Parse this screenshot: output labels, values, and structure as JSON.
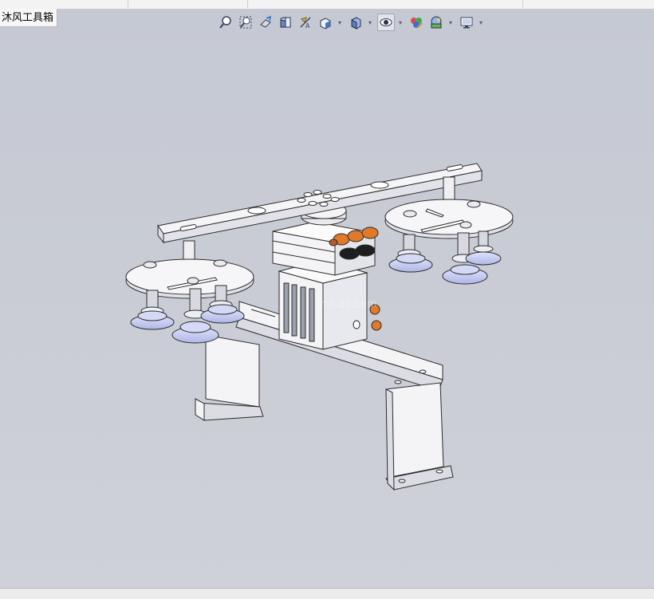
{
  "window": {
    "tab_label": "沐风工具箱",
    "watermark_text": "mfcad.com"
  },
  "hud_toolbar": {
    "buttons": [
      {
        "icon": "zoom-to-fit-icon"
      },
      {
        "icon": "zoom-to-area-icon"
      },
      {
        "icon": "previous-view-icon"
      },
      {
        "icon": "section-view-icon"
      },
      {
        "icon": "dynamic-annotation-icon"
      },
      {
        "icon": "view-orientation-icon",
        "has_dropdown": true
      },
      {
        "icon": "display-style-icon",
        "has_dropdown": true
      },
      {
        "icon": "hide-show-items-icon",
        "has_dropdown": true,
        "active": true
      },
      {
        "icon": "edit-appearance-icon"
      },
      {
        "icon": "apply-scene-icon",
        "has_dropdown": true
      },
      {
        "icon": "view-settings-icon",
        "has_dropdown": true
      }
    ],
    "dropdown_glyph": "▾"
  },
  "colors": {
    "viewport_bg": "#c9ccd5",
    "part_fill": "#f4f4f6",
    "part_shade": "#dcdde4",
    "edge": "#2c2c2c",
    "suction_cup": "#c6ccf0",
    "fitting_orange": "#e07a2a"
  }
}
